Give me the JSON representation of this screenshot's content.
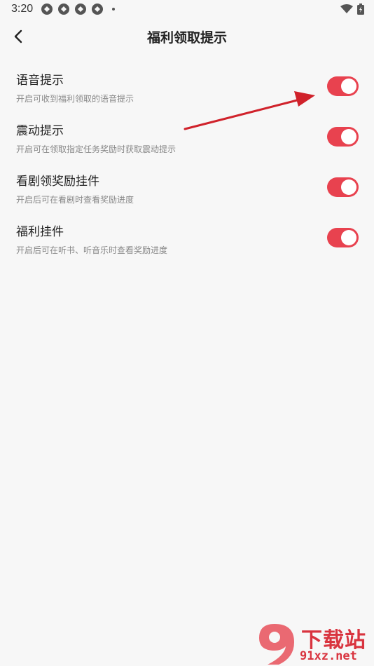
{
  "status_bar": {
    "time": "3:20",
    "icons": [
      "sync-icon",
      "sync-icon",
      "sync-icon",
      "sync-icon",
      "dot-icon",
      "wifi-icon",
      "battery-charging-icon"
    ]
  },
  "header": {
    "title": "福利领取提示",
    "back_icon": "chevron-left-icon"
  },
  "settings": [
    {
      "title": "语音提示",
      "description": "开启可收到福利领取的语音提示",
      "enabled": true
    },
    {
      "title": "震动提示",
      "description": "开启可在领取指定任务奖励时获取震动提示",
      "enabled": true
    },
    {
      "title": "看剧领奖励挂件",
      "description": "开启后可在看剧时查看奖励进度",
      "enabled": true
    },
    {
      "title": "福利挂件",
      "description": "开启后可在听书、听音乐时查看奖励进度",
      "enabled": true
    }
  ],
  "colors": {
    "toggle_on": "#e8424f",
    "background": "#f7f7f7",
    "annotation_arrow": "#d0222b",
    "watermark": "#d9343f"
  },
  "watermark": {
    "title": "下载站",
    "url": "91xz.net"
  }
}
